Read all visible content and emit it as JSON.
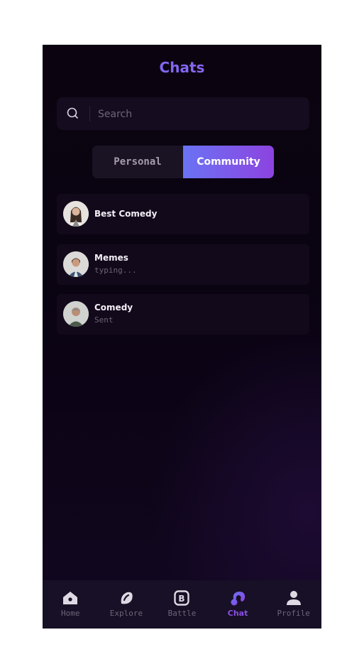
{
  "header": {
    "title": "Chats"
  },
  "search": {
    "placeholder": "Search",
    "icon": "search-icon"
  },
  "tabs": [
    {
      "label": "Personal",
      "selected": false
    },
    {
      "label": "Community",
      "selected": true
    }
  ],
  "chats": [
    {
      "name": "Best Comedy",
      "subtitle": ""
    },
    {
      "name": "Memes",
      "subtitle": "typing..."
    },
    {
      "name": "Comedy",
      "subtitle": "Sent"
    }
  ],
  "nav": {
    "items": [
      {
        "label": "Home",
        "icon": "home-icon",
        "active": false
      },
      {
        "label": "Explore",
        "icon": "explore-icon",
        "active": false
      },
      {
        "label": "Battle",
        "icon": "battle-icon",
        "active": false
      },
      {
        "label": "Chat",
        "icon": "chat-icon",
        "active": true
      },
      {
        "label": "Profile",
        "icon": "profile-icon",
        "active": false
      }
    ]
  },
  "colors": {
    "accent_start": "#6a73f4",
    "accent_end": "#8d43e0",
    "background": "#0b0410",
    "nav_background": "#171026"
  }
}
